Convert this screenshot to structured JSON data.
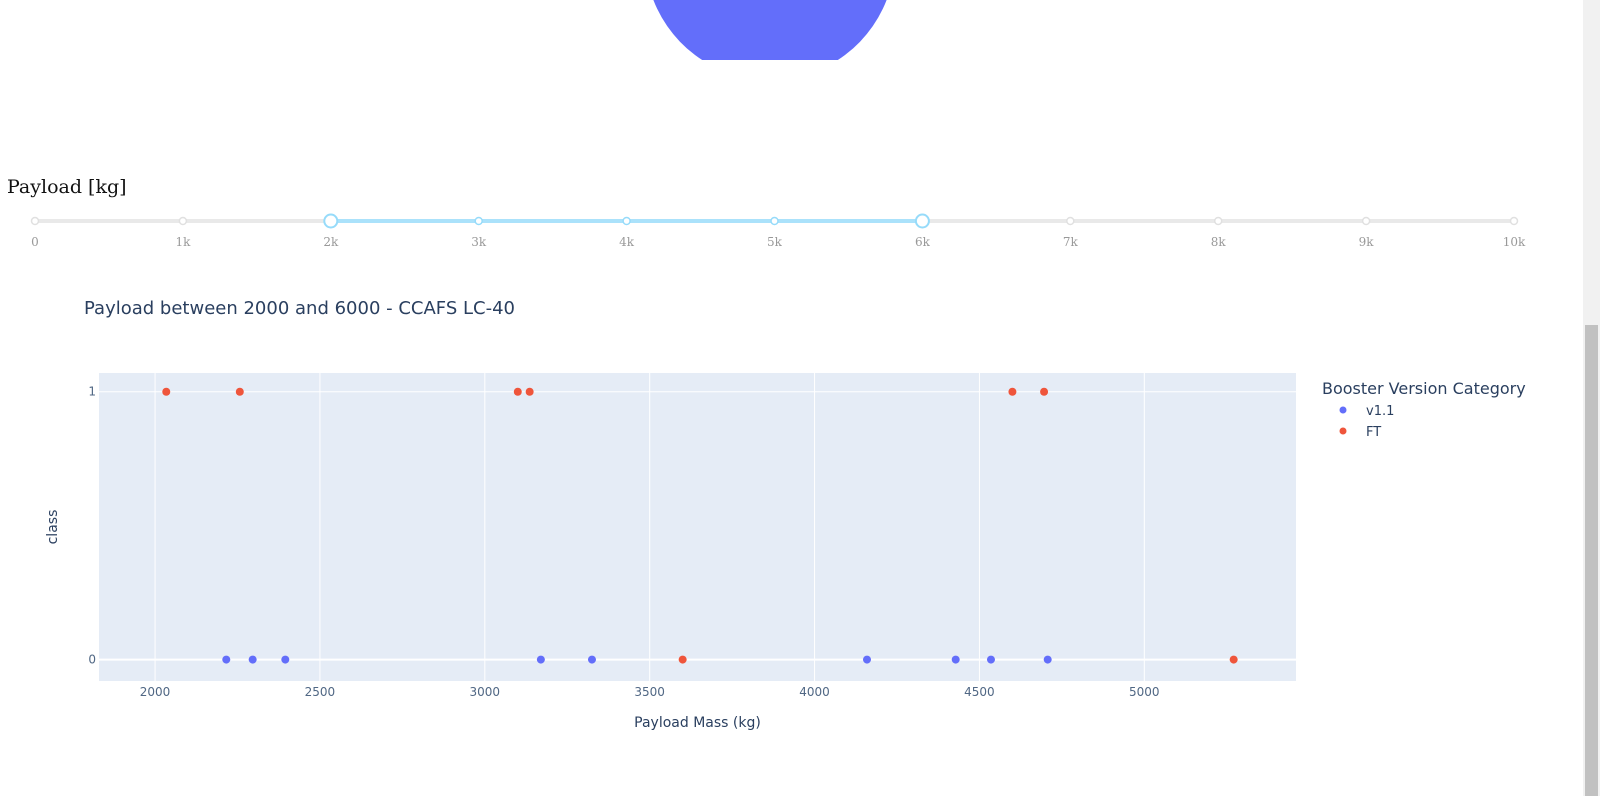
{
  "top_chart": {
    "colors": {
      "slice": "#636efa"
    }
  },
  "payload_slider": {
    "label": "Payload [kg]",
    "min": 0,
    "max": 10000,
    "selected": [
      2000,
      6000
    ],
    "ticks": [
      {
        "value": 0,
        "label": "0"
      },
      {
        "value": 1000,
        "label": "1k"
      },
      {
        "value": 2000,
        "label": "2k"
      },
      {
        "value": 3000,
        "label": "3k"
      },
      {
        "value": 4000,
        "label": "4k"
      },
      {
        "value": 5000,
        "label": "5k"
      },
      {
        "value": 6000,
        "label": "6k"
      },
      {
        "value": 7000,
        "label": "7k"
      },
      {
        "value": 8000,
        "label": "8k"
      },
      {
        "value": 9000,
        "label": "9k"
      },
      {
        "value": 10000,
        "label": "10k"
      }
    ],
    "colors": {
      "rail": "#e9e9e9",
      "track": "#abe2fb",
      "handle": "#96dbfa"
    }
  },
  "chart_data": {
    "type": "scatter",
    "title": "Payload between 2000 and 6000 - CCAFS LC-40",
    "xlabel": "Payload Mass (kg)",
    "ylabel": "class",
    "xlim": [
      1830,
      5460
    ],
    "ylim": [
      -0.08,
      1.07
    ],
    "xticks": [
      2000,
      2500,
      3000,
      3500,
      4000,
      4500,
      5000
    ],
    "yticks": [
      0,
      1
    ],
    "grid": true,
    "legend_title": "Booster Version Category",
    "legend_position": "right",
    "colors": {
      "plot_bg": "#e5ecf6",
      "grid": "#ffffff",
      "text": "#2a3f5f",
      "tick_text": "#506784"
    },
    "series": [
      {
        "name": "v1.1",
        "color": "#636efa",
        "x": [
          2216,
          2296,
          2395,
          3170,
          3325,
          4159,
          4428,
          4535,
          4707
        ],
        "y": [
          0,
          0,
          0,
          0,
          0,
          0,
          0,
          0,
          0
        ]
      },
      {
        "name": "FT",
        "color": "#ef553b",
        "x": [
          2034,
          2257,
          3100,
          3136,
          3600,
          4600,
          4696,
          5271
        ],
        "y": [
          1,
          1,
          1,
          1,
          0,
          1,
          1,
          0
        ]
      }
    ]
  }
}
